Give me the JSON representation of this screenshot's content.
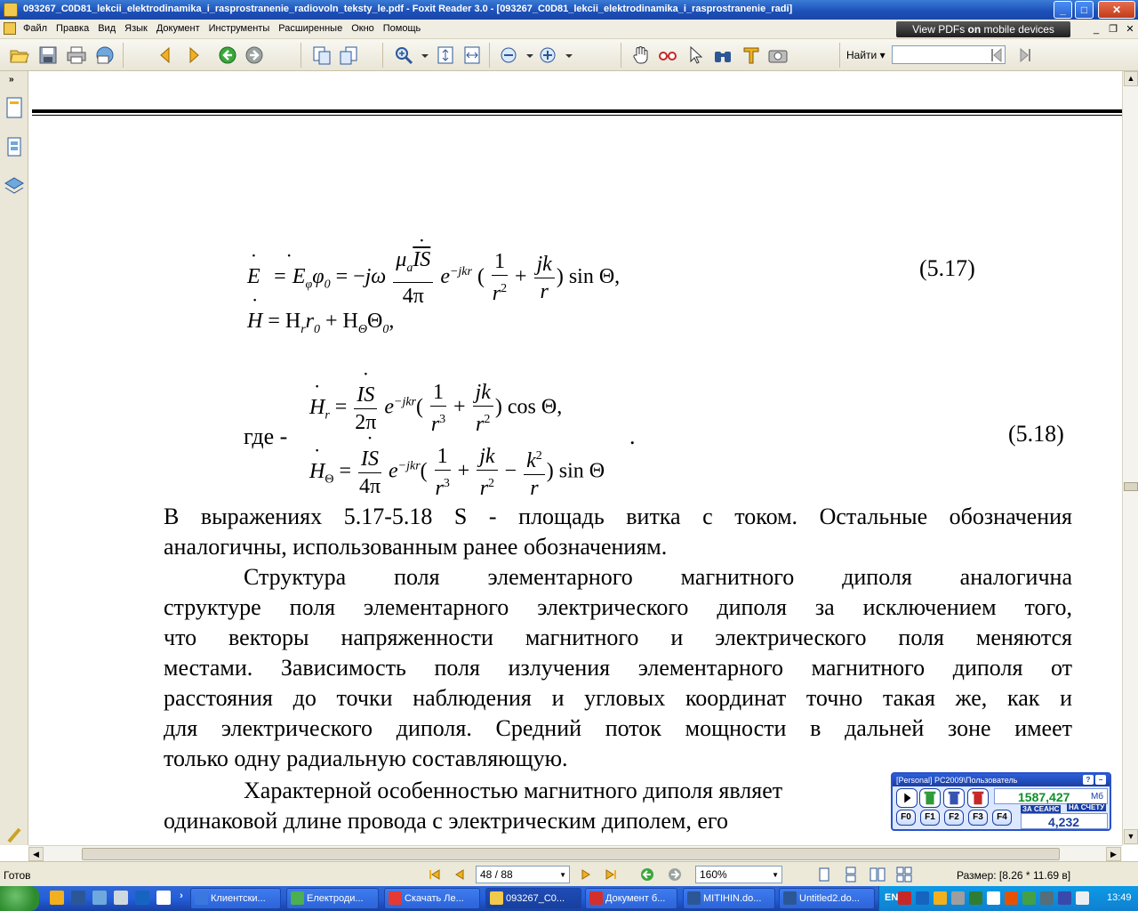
{
  "window": {
    "title": "093267_C0D81_lekcii_elektrodinamika_i_rasprostranenie_radiovoln_teksty_le.pdf - Foxit Reader 3.0 - [093267_C0D81_lekcii_elektrodinamika_i_rasprostranenie_radi]",
    "controls": {
      "minimize": "_",
      "maximize": "□",
      "close": "✕"
    },
    "mdi_controls": {
      "minimize": "_",
      "restore": "❐",
      "close": "✕"
    }
  },
  "menu": {
    "items": [
      "Файл",
      "Правка",
      "Вид",
      "Язык",
      "Документ",
      "Инструменты",
      "Расширенные",
      "Окно",
      "Помощь"
    ],
    "promo": {
      "lead": "View PDFs ",
      "on": "on",
      "tail": " mobile devices"
    }
  },
  "toolbar": {
    "find_label": "Найти",
    "find_value": "",
    "icons": [
      "open-icon",
      "save-icon",
      "print-icon",
      "email-icon",
      "back-arrow-icon",
      "forward-arrow-icon",
      "go-next-view-icon",
      "go-prev-view-icon",
      "extract-page-icon",
      "rotate-page-icon",
      "zoom-in-icon",
      "fit-page-icon",
      "fit-width-icon",
      "zoom-out-icon",
      "zoom-plus-icon",
      "hand-tool-icon",
      "glasses-icon",
      "select-arrow-icon",
      "binoculars-icon",
      "text-select-icon",
      "snapshot-icon",
      "find-prev-icon",
      "find-next-icon"
    ]
  },
  "document": {
    "eq517": {
      "lhs": "E",
      "rhs1": "= E",
      "sub1": "φ",
      "phi": "φ",
      "sub0": "0",
      "rhs2": " = −",
      "jw": "jω",
      "mu": "μ",
      "mu_sub": "a",
      "IS": "IS",
      "den1": "4π",
      "exp": "e",
      "exp_sup": "−jkr",
      "open": " (",
      "one": "1",
      "r2": "r",
      "r2_sup": "2",
      "plus": " + ",
      "jk": "jk",
      "r": "r",
      "close": ") sin Θ,",
      "number": "(5.17)"
    },
    "eqH": {
      "lhs": "H",
      "rhs": "= H",
      "sub_r": "r",
      "r0": "r",
      "r0_sub": "0",
      "plus": " + H",
      "sub_theta": "Θ",
      "theta0": "Θ",
      "theta0_sub": "0",
      "end": ","
    },
    "eq518": {
      "where": "где  -",
      "dot": ".",
      "number": "(5.18)",
      "Hr": {
        "lhs": "H",
        "lhs_sub": "r",
        "eq": " = ",
        "IS": "IS",
        "den": "2π",
        "exp": "e",
        "exp_sup": "−jkr",
        "one": "1",
        "r3": "r",
        "r3_sup": "3",
        "plus": " + ",
        "jk": "jk",
        "r2": "r",
        "r2_sup": "2",
        "close": ") cos Θ,"
      },
      "Ht": {
        "lhs": "H",
        "lhs_sub": "Θ",
        "eq": " = ",
        "IS": "IS",
        "den": "4π",
        "exp": "e",
        "exp_sup": "−jkr",
        "one": "1",
        "r3": "r",
        "r3_sup": "3",
        "plus": " + ",
        "jk": "jk",
        "r2": "r",
        "r2_sup": "2",
        "minus": " − ",
        "k2": "k",
        "k2_sup": "2",
        "r": "r",
        "close": ") sin Θ"
      }
    },
    "paragraphs": [
      [
        "В выражениях 5.17-5.18  S -  площадь витка с током. Остальные обозначения",
        "аналогичны, использованным ранее обозначениям."
      ],
      [
        "Структура    поля    элементарного    магнитного    диполя    аналогична",
        "структуре поля элементарного электрического диполя за исключением того,",
        "что   векторы напряженности магнитного и электрического поля меняются",
        "местами.  Зависимость поля излучения элементарного магнитного диполя от",
        "расстояния до точки наблюдения и угловых координат точно такая же, как и",
        "для электрического диполя. Средний поток мощности в дальней зоне имеет",
        "только одну радиальную составляющую."
      ],
      [
        "Характерной особенностью магнитного диполя являет",
        "одинаковой  длине  провода  с  электрическим  диполем,  его"
      ]
    ]
  },
  "statusbar": {
    "status": "Готов",
    "page": "48 / 88",
    "zoom": "160%",
    "size": "Размер: [8.26 * 11.69 в]"
  },
  "widget": {
    "header": "[Personal] PC2009\\Пользователь",
    "help": "?",
    "min": "−",
    "value1": "1587,427",
    "unit1": "Мб",
    "label1": "ЗА СЕАНС",
    "label2": "НА СЧЕТУ",
    "value2": "4,232",
    "fkeys": [
      "F0",
      "F1",
      "F2",
      "F3",
      "F4"
    ]
  },
  "taskbar": {
    "tasks": [
      {
        "label": "Клиентски...",
        "icon_color": "#3a78e0"
      },
      {
        "label": "Електроди...",
        "icon_color": "#4caf50"
      },
      {
        "label": "Скачать Ле...",
        "icon_color": "#e53935"
      },
      {
        "label": "093267_C0...",
        "icon_color": "#f2c94c",
        "active": true
      },
      {
        "label": "Документ б...",
        "icon_color": "#d32f2f"
      },
      {
        "label": "MITIHIN.do...",
        "icon_color": "#2b5797"
      },
      {
        "label": "Untitled2.do...",
        "icon_color": "#2b5797"
      }
    ],
    "language": "EN",
    "clock": "13:49",
    "colors": {
      "bar": "#245edb",
      "tray": "#0c9ae6",
      "start": "#2e8b2e"
    }
  },
  "colors": {
    "titlebar": "#1b4fb8",
    "accent_green": "#0e8f2a",
    "widget_border": "#2a52c9"
  }
}
